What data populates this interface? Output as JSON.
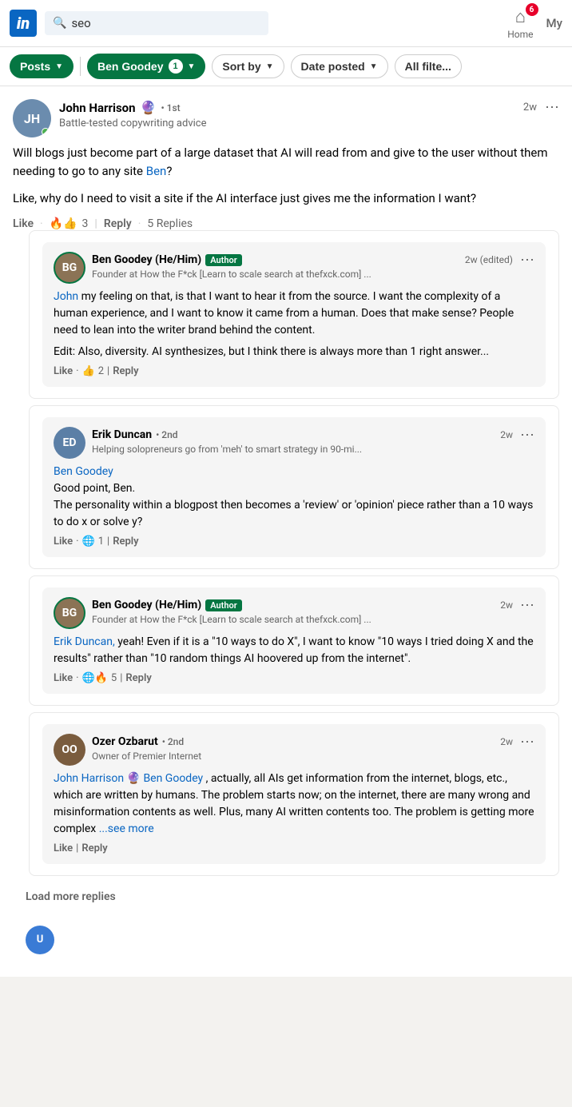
{
  "header": {
    "logo": "in",
    "search_placeholder": "seo",
    "search_value": "seo",
    "home_label": "Home",
    "my_label": "My",
    "notification_count": "6"
  },
  "filter_bar": {
    "posts_label": "Posts",
    "ben_goodey_label": "Ben Goodey",
    "ben_goodey_count": "1",
    "sort_by_label": "Sort by",
    "date_posted_label": "Date posted",
    "all_filters_label": "All filte..."
  },
  "post": {
    "author_name": "John Harrison",
    "author_badge": "🔮",
    "connection": "• 1st",
    "time": "2w",
    "subtitle": "Battle-tested copywriting advice",
    "text_parts": [
      "Will blogs just become part of a large dataset that AI will read from and give to the user without them needing to go to any site ",
      "Ben",
      "?"
    ],
    "text2": "Like, why do I need to visit a site if the AI interface just gives me the information I want?",
    "reactions": "🔥👍",
    "reaction_count": "3",
    "reply_label": "Reply",
    "replies_label": "5 Replies",
    "like_label": "Like"
  },
  "comments": [
    {
      "id": "c1",
      "author": "Ben Goodey (He/Him)",
      "author_badge": "Author",
      "time": "2w (edited)",
      "subtitle": "Founder at How the F*ck [Learn to scale search at thefxck.com] ...",
      "mention": "John",
      "text": " my feeling on that, is that I want to hear it from the source. I want the complexity of a human experience, and I want to know it came from a human. Does that make sense? People need to lean into the writer brand behind the content.",
      "edit_note": "Edit: Also, diversity. AI synthesizes, but I think there is always more than 1 right answer...",
      "reactions": "👍",
      "reaction_count": "2",
      "like_label": "Like",
      "reply_label": "Reply",
      "avatar_color": "#8b7355",
      "avatar_initials": "BG"
    },
    {
      "id": "c2",
      "author": "Erik Duncan",
      "connection": "• 2nd",
      "time": "2w",
      "subtitle": "Helping solopreneurs go from 'meh' to smart strategy in 90-mi...",
      "mention_name": "Ben Goodey",
      "text": "Good point, Ben.\nThe personality within a blogpost then becomes a 'review' or 'opinion' piece rather than a 10 ways to do x or solve y?",
      "reactions": "🌐",
      "reaction_count": "1",
      "like_label": "Like",
      "reply_label": "Reply",
      "avatar_color": "#5b7fa6",
      "avatar_initials": "ED"
    },
    {
      "id": "c3",
      "author": "Ben Goodey (He/Him)",
      "author_badge": "Author",
      "time": "2w",
      "subtitle": "Founder at How the F*ck [Learn to scale search at thefxck.com] ...",
      "mention": "Erik Duncan,",
      "text": " yeah! Even if it is a \"10 ways to do X\", I want to know \"10 ways I tried doing X and the results\" rather than \"10 random things AI hoovered up from the internet\".",
      "reactions": "🌐🔥",
      "reaction_count": "5",
      "like_label": "Like",
      "reply_label": "Reply",
      "avatar_color": "#8b7355",
      "avatar_initials": "BG"
    },
    {
      "id": "c4",
      "author": "Ozer Ozbarut",
      "connection": "• 2nd",
      "time": "2w",
      "subtitle": "Owner of Premier Internet",
      "mention1": "John Harrison",
      "mention1_badge": "🔮",
      "mention2": "Ben Goodey",
      "text": ", actually, all AIs get information from the internet, blogs, etc., which are written by humans. The problem starts now; on the internet, there are many wrong and misinformation contents as well. Plus, many AI written contents too. The problem is getting more complex",
      "see_more": "...see more",
      "like_label": "Like",
      "reply_label": "Reply",
      "avatar_color": "#7a5c3e",
      "avatar_initials": "OO"
    }
  ],
  "load_more_label": "Load more replies",
  "bottom_avatar_color": "#3a7bd5",
  "bottom_avatar_initials": "U"
}
